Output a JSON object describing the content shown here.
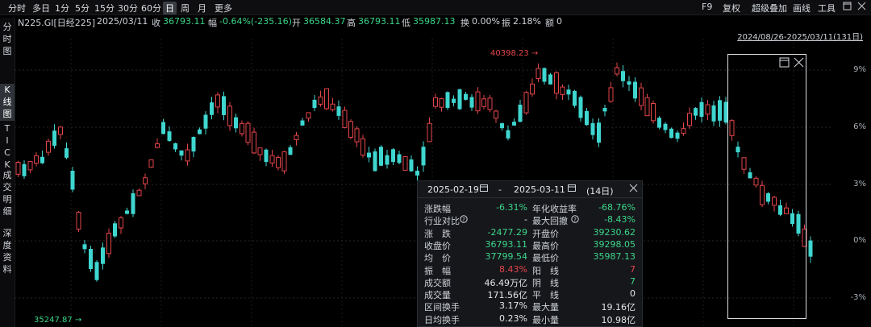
{
  "toolbar": {
    "tabs": [
      "分时",
      "多日",
      "1分",
      "5分",
      "15分",
      "30分",
      "60分",
      "日",
      "周",
      "月",
      "更多"
    ],
    "active_tab": "日",
    "right": [
      "F9",
      "复权",
      "超级叠加",
      "画线",
      "工具"
    ]
  },
  "info": {
    "name": "N225.GI[日经225]",
    "date": "2025/03/11",
    "close_label": "收",
    "close_value": "36793.11",
    "change_label": "幅",
    "change_value": "-0.64%(-235.16)",
    "open_label": "开",
    "open_value": "36584.37",
    "high_label": "高",
    "high_value": "36793.11",
    "low_label": "低",
    "low_value": "35987.13",
    "turnover_label": "换",
    "turnover_value": "0.00%",
    "amplitude_label": "振",
    "amplitude_value": "2.18%",
    "amount_label": "额",
    "amount_value": "0"
  },
  "sidebar": {
    "items": [
      "分\n时\n图",
      "K\n线\n图",
      "T\nI\nC\nK",
      "成\n交\n明\n细",
      "深\n度\n资\n料"
    ]
  },
  "date_range": "2024/08/26-2025/03/11(131日)",
  "y_ticks": [
    "9%",
    "6%",
    "3%",
    "0%",
    "-3%"
  ],
  "markers": {
    "max": "40398.23",
    "min": "35247.87"
  },
  "panel": {
    "start_date": "2025-02-19",
    "sep": "-",
    "end_date": "2025-03-11",
    "days": "(14日)",
    "rows": [
      {
        "l1": "涨跌幅",
        "v1": "-6.31%",
        "c1": "green",
        "l2": "年化收益率",
        "v2": "-68.76%",
        "c2": "green"
      },
      {
        "l1": "行业对比",
        "v1": "-",
        "c1": "white",
        "l2": "最大回撤",
        "v2": "-8.43%",
        "c2": "green"
      },
      {
        "l1": "涨　跌",
        "v1": "-2477.29",
        "c1": "green",
        "l2": "开盘价",
        "v2": "39230.62",
        "c2": "green"
      },
      {
        "l1": "收盘价",
        "v1": "36793.11",
        "c1": "green",
        "l2": "最高价",
        "v2": "39298.05",
        "c2": "green"
      },
      {
        "l1": "均　价",
        "v1": "37799.54",
        "c1": "green",
        "l2": "最低价",
        "v2": "35987.13",
        "c2": "green"
      },
      {
        "l1": "振　幅",
        "v1": "8.43%",
        "c1": "red",
        "l2": "阳　线",
        "v2": "7",
        "c2": "red"
      },
      {
        "l1": "成交额",
        "v1": "46.49万亿",
        "c1": "white",
        "l2": "阴　线",
        "v2": "7",
        "c2": "green"
      },
      {
        "l1": "成交量",
        "v1": "171.56亿",
        "c1": "white",
        "l2": "平　线",
        "v2": "0",
        "c2": "white"
      },
      {
        "l1": "区间换手",
        "v1": "3.17%",
        "c1": "white",
        "l2": "最大量",
        "v2": "19.16亿",
        "c2": "white"
      },
      {
        "l1": "日均换手",
        "v1": "0.23%",
        "c1": "white",
        "l2": "最小量",
        "v2": "10.98亿",
        "c2": "white"
      }
    ]
  },
  "colors": {
    "up": "#e3454a",
    "down": "#3fd6d0",
    "bg": "#000000",
    "grid": "#2a2a2e"
  }
}
